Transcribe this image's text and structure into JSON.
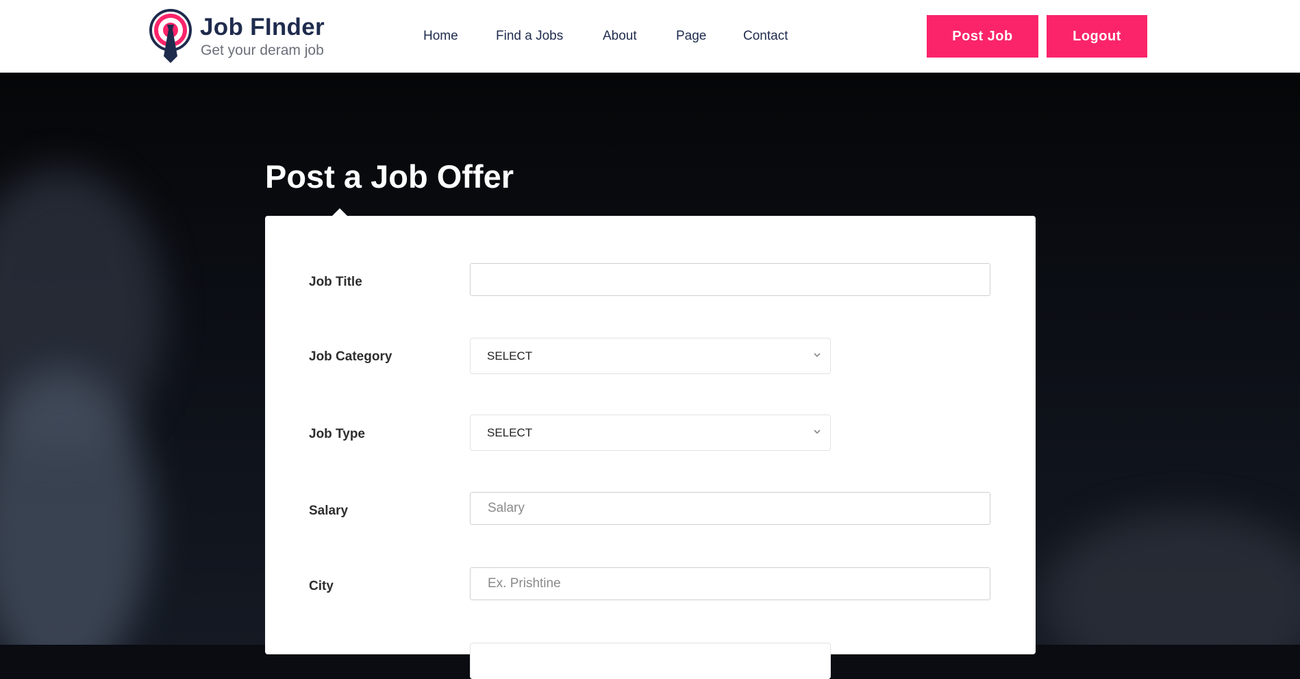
{
  "header": {
    "logo": {
      "name": "Job FInder",
      "tagline": "Get your deram job",
      "colors": {
        "ring": "#fb246a",
        "dark": "#1f2b4d"
      }
    },
    "nav": [
      {
        "label": "Home"
      },
      {
        "label": "Find a Jobs"
      },
      {
        "label": "About"
      },
      {
        "label": "Page"
      },
      {
        "label": "Contact"
      }
    ],
    "post_job_label": "Post Job",
    "logout_label": "Logout"
  },
  "main": {
    "title": "Post a Job Offer",
    "form": {
      "job_title": {
        "label": "Job Title",
        "value": "",
        "placeholder": ""
      },
      "job_category": {
        "label": "Job Category",
        "selected": "SELECT"
      },
      "job_type": {
        "label": "Job Type",
        "selected": "SELECT"
      },
      "salary": {
        "label": "Salary",
        "value": "",
        "placeholder": "Salary"
      },
      "city": {
        "label": "City",
        "value": "",
        "placeholder": "Ex. Prishtine"
      }
    }
  },
  "theme": {
    "accent": "#fb246a",
    "nav_text": "#1f2b4d",
    "card_bg": "#ffffff"
  }
}
